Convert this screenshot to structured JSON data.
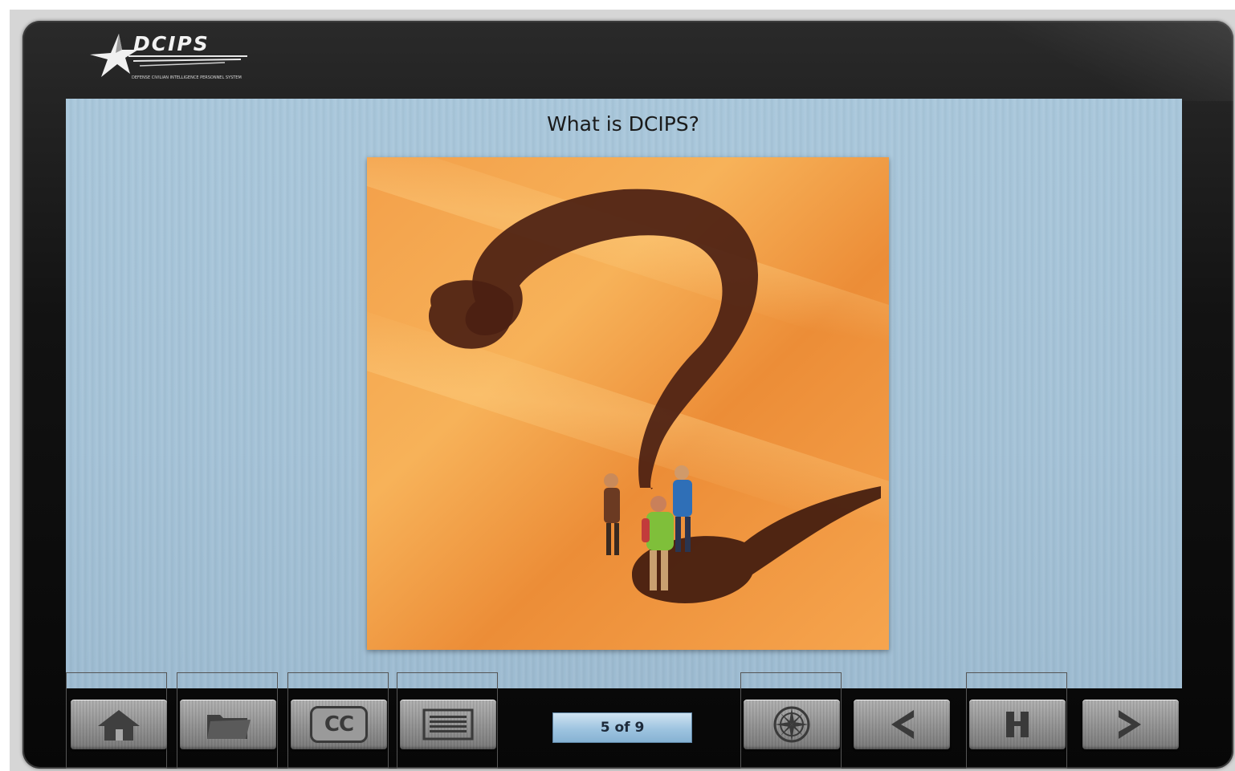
{
  "brand": {
    "logo_text": "DCIPS",
    "logo_subtitle": "Defense Civilian Intelligence Personnel System"
  },
  "slide": {
    "title": "What is DCIPS?"
  },
  "toolbar": {
    "buttons": [
      {
        "name": "home",
        "icon": "home-icon"
      },
      {
        "name": "resources",
        "icon": "folder-icon"
      },
      {
        "name": "closed-captions",
        "icon": "cc-icon",
        "label": "CC"
      },
      {
        "name": "menu",
        "icon": "list-icon"
      },
      {
        "name": "glossary",
        "icon": "compass-icon"
      },
      {
        "name": "back",
        "icon": "chevron-left-icon"
      },
      {
        "name": "pause",
        "icon": "pause-icon"
      },
      {
        "name": "next",
        "icon": "chevron-right-icon"
      }
    ],
    "page_counter": "5 of 9"
  },
  "colors": {
    "screen_bg": "#a9c7db",
    "frame": "#121212",
    "photo_orange": "#f0963a",
    "counter_blue": "#9ec4e0"
  }
}
